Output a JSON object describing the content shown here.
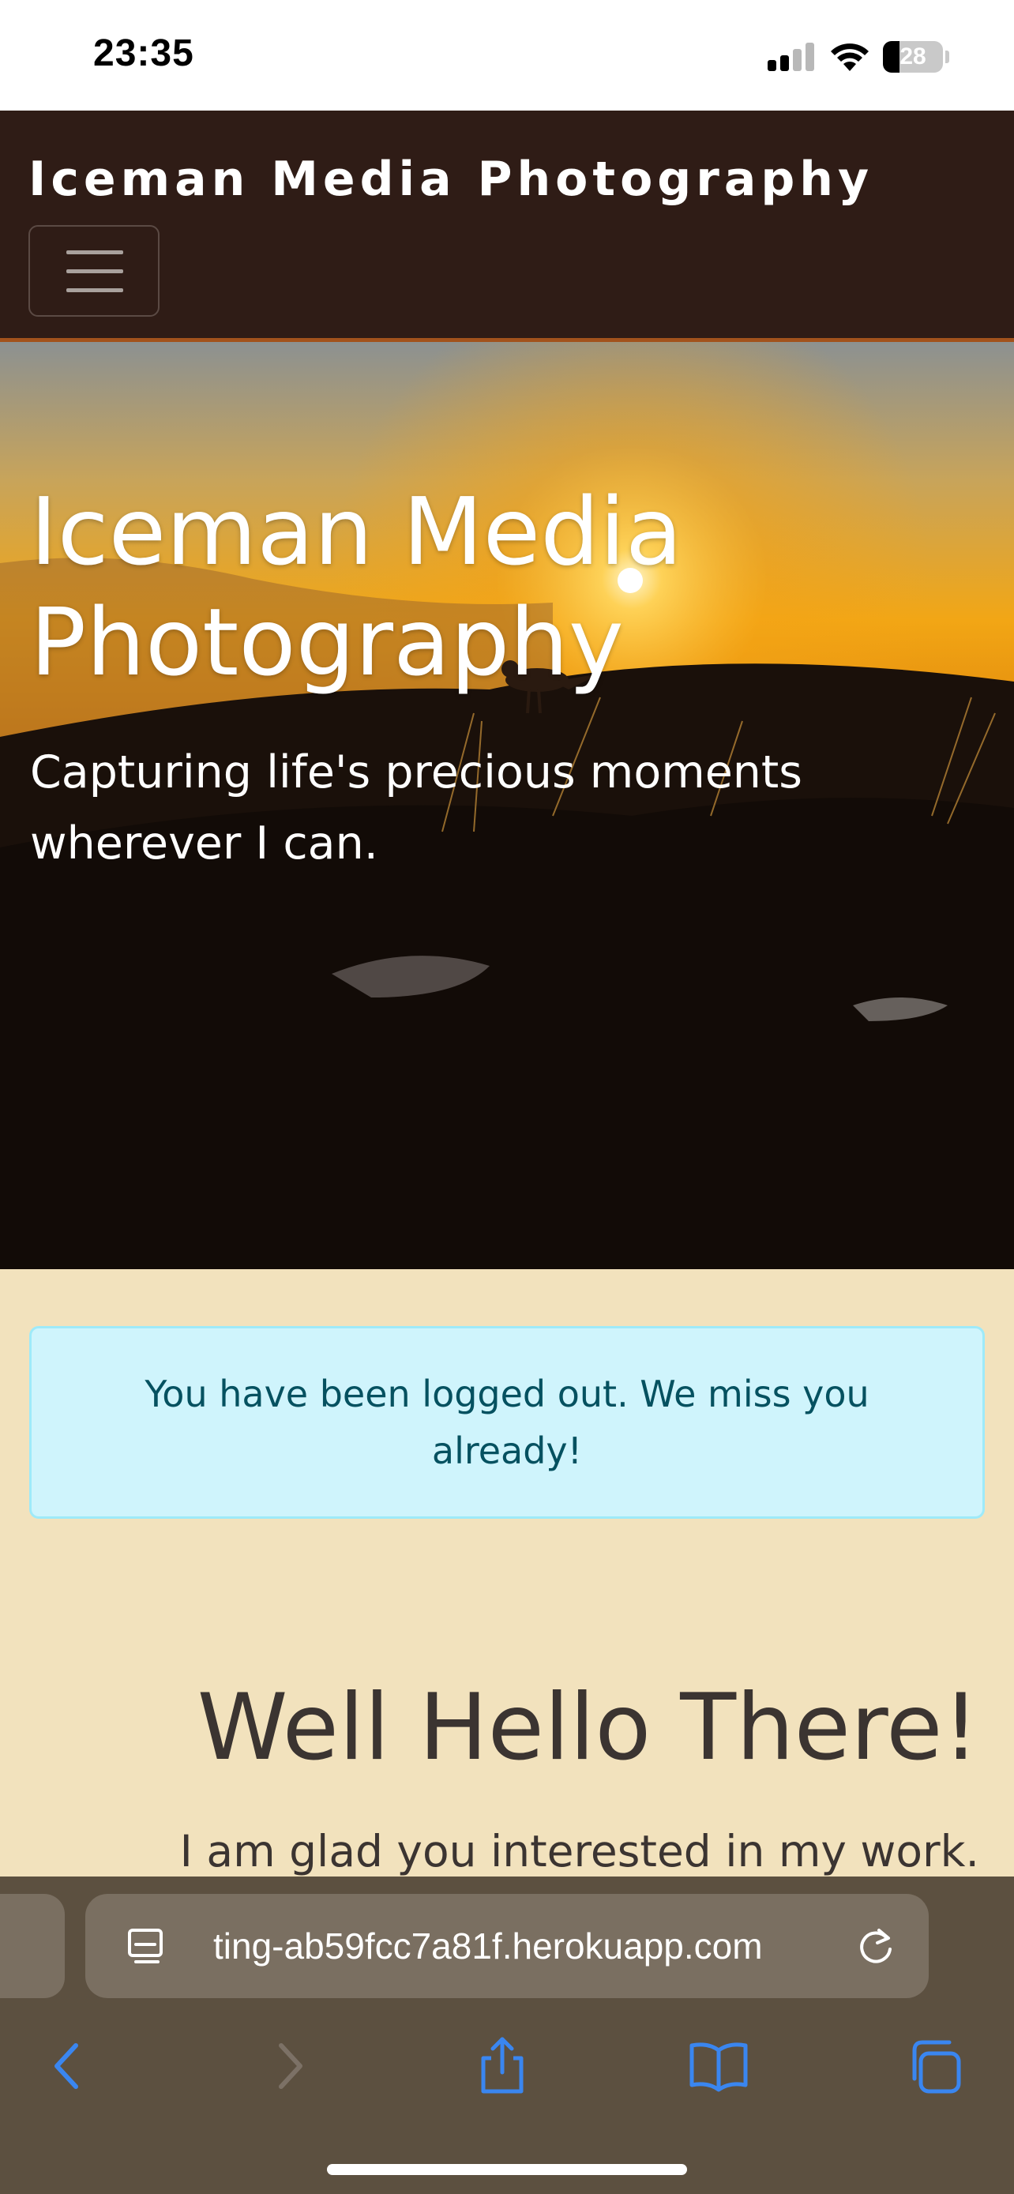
{
  "status_bar": {
    "time": "23:35",
    "battery_level": "28"
  },
  "navbar": {
    "brand": "Iceman Media Photography",
    "accent_color": "#a2521c"
  },
  "hero": {
    "title": "Iceman Media Photography",
    "subtitle": "Capturing life's precious moments wherever I can."
  },
  "alert": {
    "message": "You have been logged out. We miss you already!",
    "type": "info"
  },
  "welcome": {
    "heading": "Well Hello There!",
    "text": "I am glad you interested in my work."
  },
  "browser": {
    "url": "ting-ab59fcc7a81f.herokuapp.com",
    "toolbar_icons": [
      "back-icon",
      "forward-icon",
      "share-icon",
      "bookmarks-icon",
      "tabs-icon"
    ],
    "icon_color": "#3a86f0"
  }
}
